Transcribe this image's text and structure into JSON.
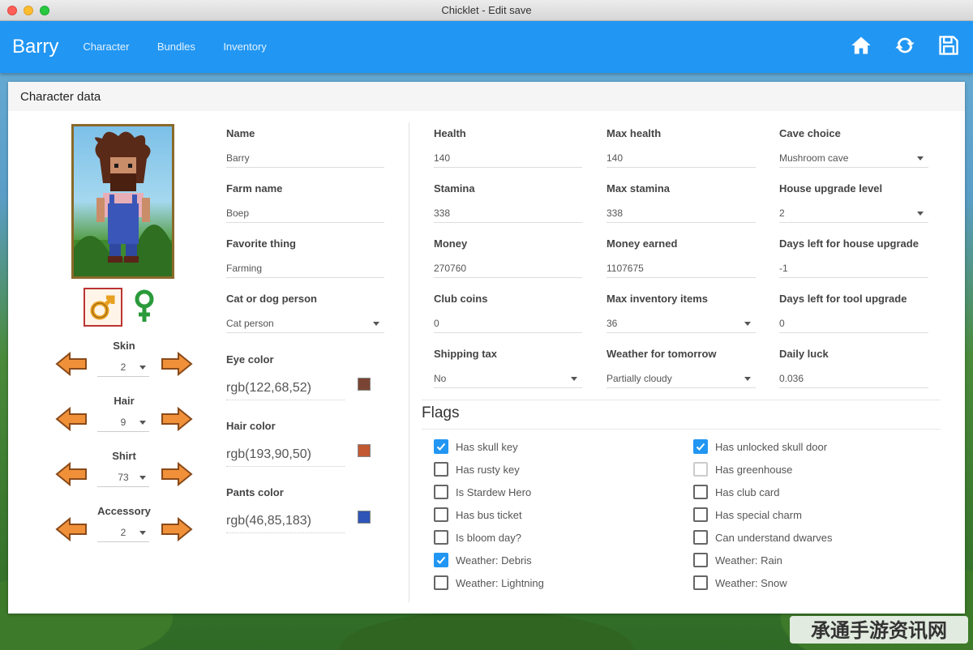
{
  "window": {
    "title": "Chicklet - Edit save"
  },
  "appbar": {
    "brand": "Barry",
    "nav": [
      "Character",
      "Bundles",
      "Inventory"
    ],
    "icons": [
      "home-icon",
      "refresh-icon",
      "save-icon"
    ]
  },
  "card": {
    "title": "Character data"
  },
  "appearance": {
    "selectors": [
      {
        "label": "Skin",
        "value": "2"
      },
      {
        "label": "Hair",
        "value": "9"
      },
      {
        "label": "Shirt",
        "value": "73"
      },
      {
        "label": "Accessory",
        "value": "2"
      }
    ]
  },
  "fields": {
    "name": {
      "label": "Name",
      "value": "Barry"
    },
    "farm_name": {
      "label": "Farm name",
      "value": "Boep"
    },
    "favorite_thing": {
      "label": "Favorite thing",
      "value": "Farming"
    },
    "cat_or_dog": {
      "label": "Cat or dog person",
      "value": "Cat person"
    },
    "health": {
      "label": "Health",
      "value": "140"
    },
    "max_health": {
      "label": "Max health",
      "value": "140"
    },
    "cave_choice": {
      "label": "Cave choice",
      "value": "Mushroom cave"
    },
    "stamina": {
      "label": "Stamina",
      "value": "338"
    },
    "max_stamina": {
      "label": "Max stamina",
      "value": "338"
    },
    "house_upgrade_level": {
      "label": "House upgrade level",
      "value": "2"
    },
    "money": {
      "label": "Money",
      "value": "270760"
    },
    "money_earned": {
      "label": "Money earned",
      "value": "1107675"
    },
    "days_house_upgrade": {
      "label": "Days left for house upgrade",
      "value": "-1"
    },
    "club_coins": {
      "label": "Club coins",
      "value": "0"
    },
    "max_inventory": {
      "label": "Max inventory items",
      "value": "36"
    },
    "days_tool_upgrade": {
      "label": "Days left for tool upgrade",
      "value": "0"
    },
    "shipping_tax": {
      "label": "Shipping tax",
      "value": "No"
    },
    "weather_tomorrow": {
      "label": "Weather for tomorrow",
      "value": "Partially cloudy"
    },
    "daily_luck": {
      "label": "Daily luck",
      "value": "0.036"
    }
  },
  "colors": {
    "eye": {
      "label": "Eye color",
      "value": "rgb(122,68,52)",
      "hex": "#7a4434"
    },
    "hair": {
      "label": "Hair color",
      "value": "rgb(193,90,50)",
      "hex": "#c15a32"
    },
    "pants": {
      "label": "Pants color",
      "value": "rgb(46,85,183)",
      "hex": "#2e55b7"
    }
  },
  "flags": {
    "title": "Flags",
    "left": [
      {
        "label": "Has skull key",
        "checked": true
      },
      {
        "label": "Has rusty key",
        "checked": false
      },
      {
        "label": "Is Stardew Hero",
        "checked": false
      },
      {
        "label": "Has bus ticket",
        "checked": false
      },
      {
        "label": "Is bloom day?",
        "checked": false
      },
      {
        "label": "Weather: Debris",
        "checked": true
      },
      {
        "label": "Weather: Lightning",
        "checked": false
      }
    ],
    "right": [
      {
        "label": "Has unlocked skull door",
        "checked": true
      },
      {
        "label": "Has greenhouse",
        "checked": false,
        "disabled": true
      },
      {
        "label": "Has club card",
        "checked": false
      },
      {
        "label": "Has special charm",
        "checked": false
      },
      {
        "label": "Can understand dwarves",
        "checked": false
      },
      {
        "label": "Weather: Rain",
        "checked": false
      },
      {
        "label": "Weather: Snow",
        "checked": false
      }
    ]
  },
  "theme": {
    "accent": "#2196f3",
    "checkbox_checked": "#2196f3"
  },
  "watermark": {
    "text": "承通手游资讯网"
  }
}
